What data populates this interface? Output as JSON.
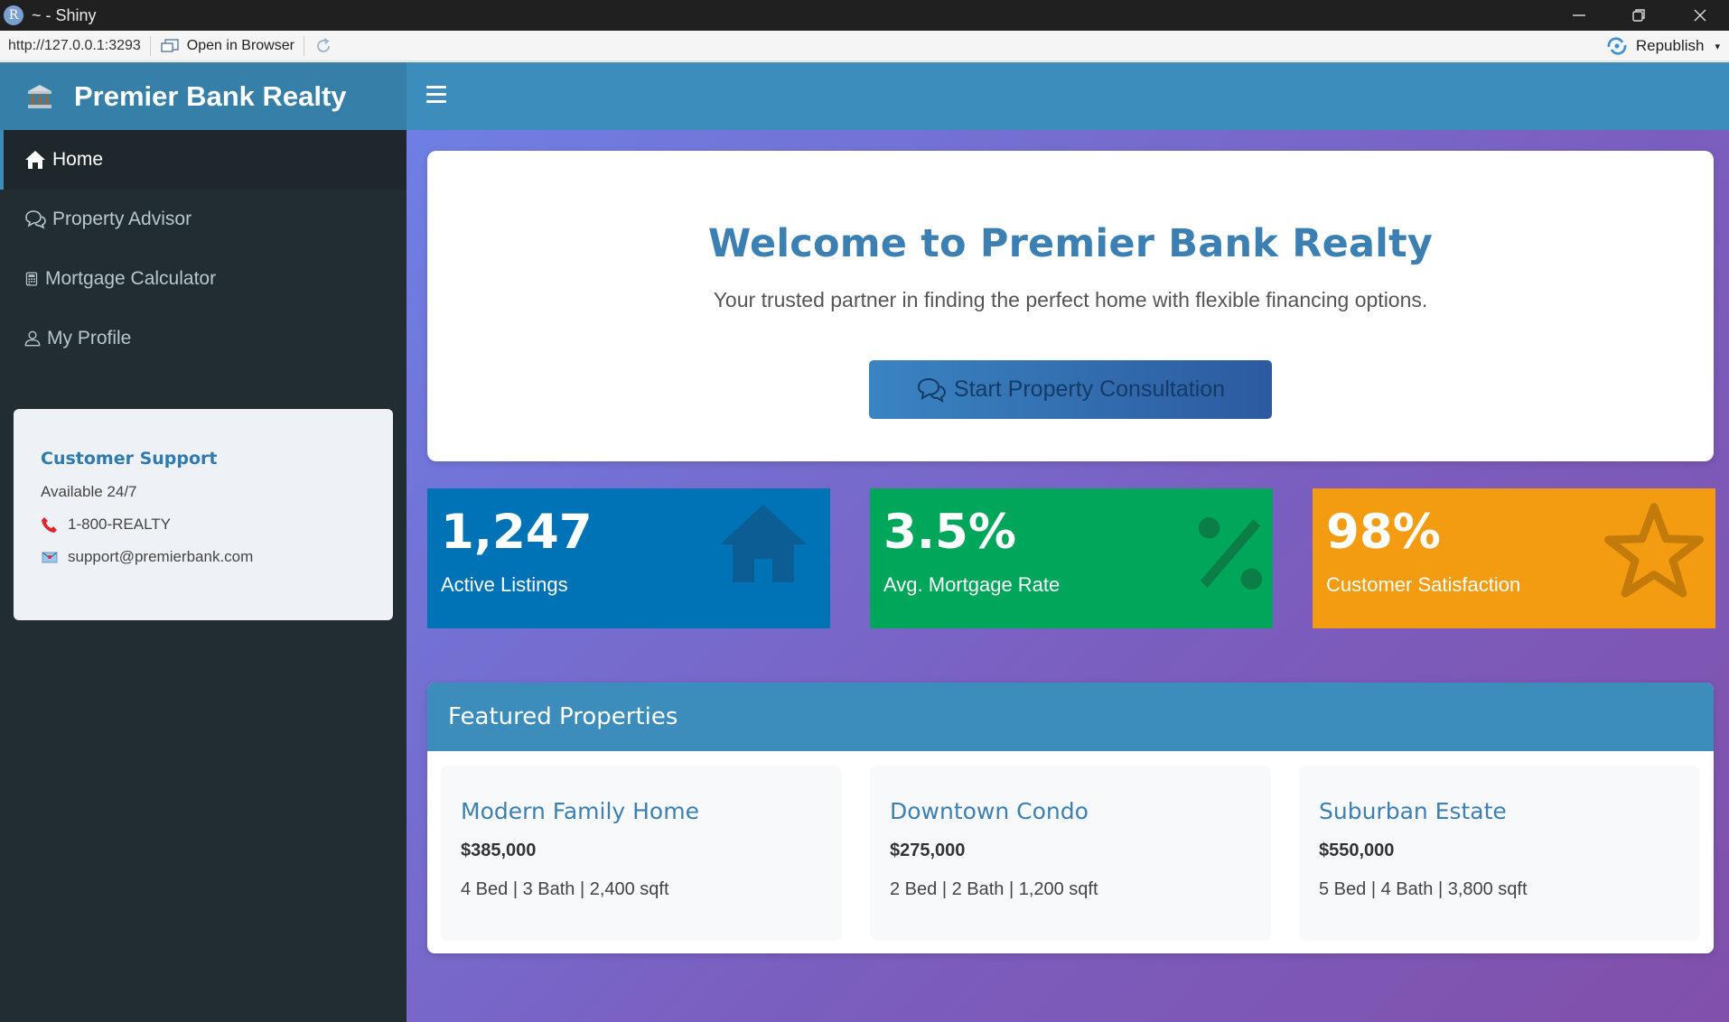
{
  "window": {
    "title": "~ - Shiny",
    "app_icon_letter": "R"
  },
  "addressbar": {
    "url": "http://127.0.0.1:3293",
    "open_label": "Open in Browser",
    "republish_label": "Republish"
  },
  "sidebar": {
    "brand": "Premier Bank Realty",
    "items": [
      {
        "label": "Home",
        "icon": "home-icon",
        "active": true
      },
      {
        "label": "Property Advisor",
        "icon": "comments-icon",
        "active": false
      },
      {
        "label": "Mortgage Calculator",
        "icon": "calculator-icon",
        "active": false
      },
      {
        "label": "My Profile",
        "icon": "user-icon",
        "active": false
      }
    ],
    "support": {
      "title": "Customer Support",
      "availability": "Available 24/7",
      "phone": "1-800-REALTY",
      "email": "support@premierbank.com"
    }
  },
  "hero": {
    "title": "Welcome to Premier Bank Realty",
    "subtitle": "Your trusted partner in finding the perfect home with flexible financing options.",
    "cta_label": "Start Property Consultation"
  },
  "stats": [
    {
      "value": "1,247",
      "label": "Active Listings",
      "icon": "home-icon",
      "color": "#0073b7"
    },
    {
      "value": "3.5%",
      "label": "Avg. Mortgage Rate",
      "icon": "percent-icon",
      "color": "#00a65a"
    },
    {
      "value": "98%",
      "label": "Customer Satisfaction",
      "icon": "star-icon",
      "color": "#f39c12"
    }
  ],
  "featured": {
    "title": "Featured Properties",
    "properties": [
      {
        "name": "Modern Family Home",
        "price": "$385,000",
        "specs": "4 Bed | 3 Bath | 2,400 sqft"
      },
      {
        "name": "Downtown Condo",
        "price": "$275,000",
        "specs": "2 Bed | 2 Bath | 1,200 sqft"
      },
      {
        "name": "Suburban Estate",
        "price": "$550,000",
        "specs": "5 Bed | 4 Bath | 3,800 sqft"
      }
    ]
  },
  "colors": {
    "header": "#3c8dbc",
    "brand_bar": "#367fa9",
    "sidebar": "#222d32",
    "accent_text": "#3c80b3"
  }
}
